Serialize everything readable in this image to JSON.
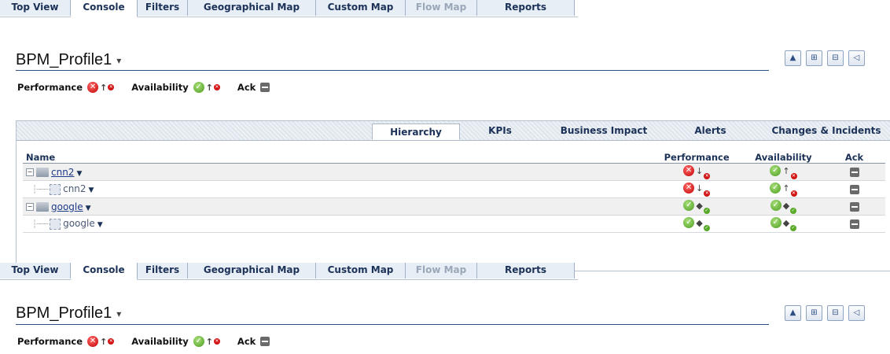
{
  "nav": [
    "Top View",
    "Console",
    "Filters",
    "Geographical Map",
    "Custom Map",
    "Flow Map",
    "Reports"
  ],
  "title": "BPM_Profile1",
  "title_caret": "▾",
  "toolbar_icons": [
    "collapse-up-icon",
    "expand-tree-icon",
    "collapse-tree-icon",
    "speaker-icon"
  ],
  "status": {
    "performance_label": "Performance",
    "availability_label": "Availability",
    "ack_label": "Ack"
  },
  "panel_tabs": [
    "Hierarchy",
    "KPIs",
    "Business Impact",
    "Alerts",
    "Changes & Incidents"
  ],
  "columns": [
    "Name",
    "Performance",
    "Availability",
    "Ack"
  ],
  "rows": [
    {
      "name": "cnn2",
      "level": 0
    },
    {
      "name": "cnn2",
      "level": 1
    },
    {
      "name": "google",
      "level": 0
    },
    {
      "name": "google",
      "level": 1
    }
  ],
  "colors": {
    "accent": "#1b3157",
    "red": "#c20000",
    "green": "#4d9c1f"
  }
}
